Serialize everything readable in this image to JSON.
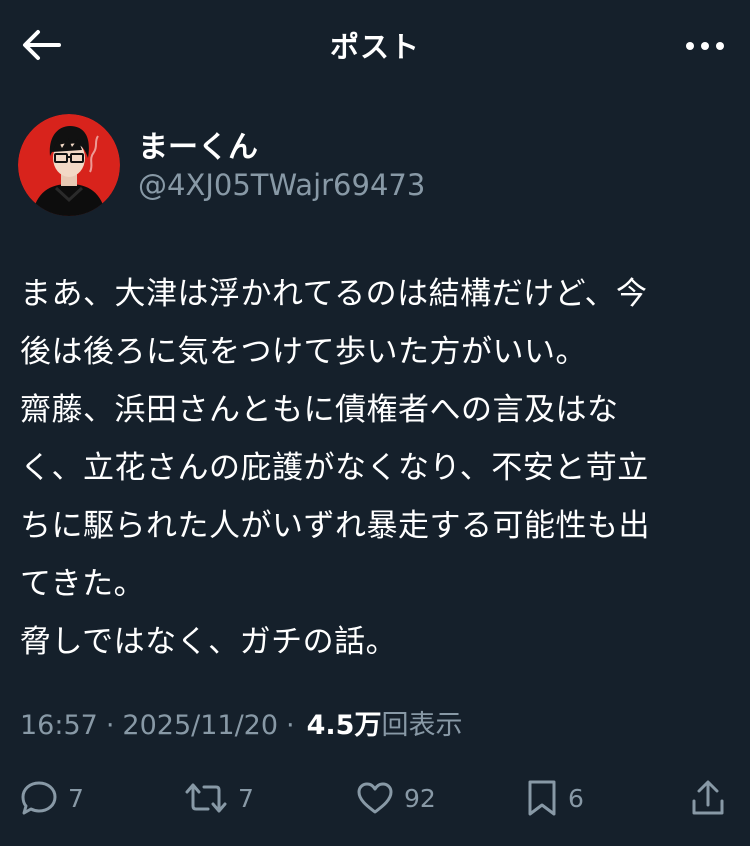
{
  "header": {
    "title": "ポスト",
    "back_icon": "arrow-left-icon",
    "more_icon": "more-horizontal-icon"
  },
  "author": {
    "display_name": "まーくん",
    "handle": "@4XJ05TWajr69473"
  },
  "post": {
    "lines": [
      "まあ、大津は浮かれてるのは結構だけど、今",
      "後は後ろに気をつけて歩いた方がいい。",
      "齋藤、浜田さんともに債権者への言及はな",
      "く、立花さんの庇護がなくなり、不安と苛立",
      "ちに駆られた人がいずれ暴走する可能性も出",
      "てきた。",
      "脅しではなく、ガチの話。"
    ]
  },
  "meta": {
    "time": "16:57",
    "separator": "·",
    "date": "2025/11/20",
    "views_count": "4.5万",
    "views_label": "回表示"
  },
  "actions": {
    "replies": "7",
    "reposts": "7",
    "likes": "92",
    "bookmarks": "6"
  },
  "colors": {
    "background": "#15202b",
    "text": "#ffffff",
    "secondary": "#8899a6"
  }
}
